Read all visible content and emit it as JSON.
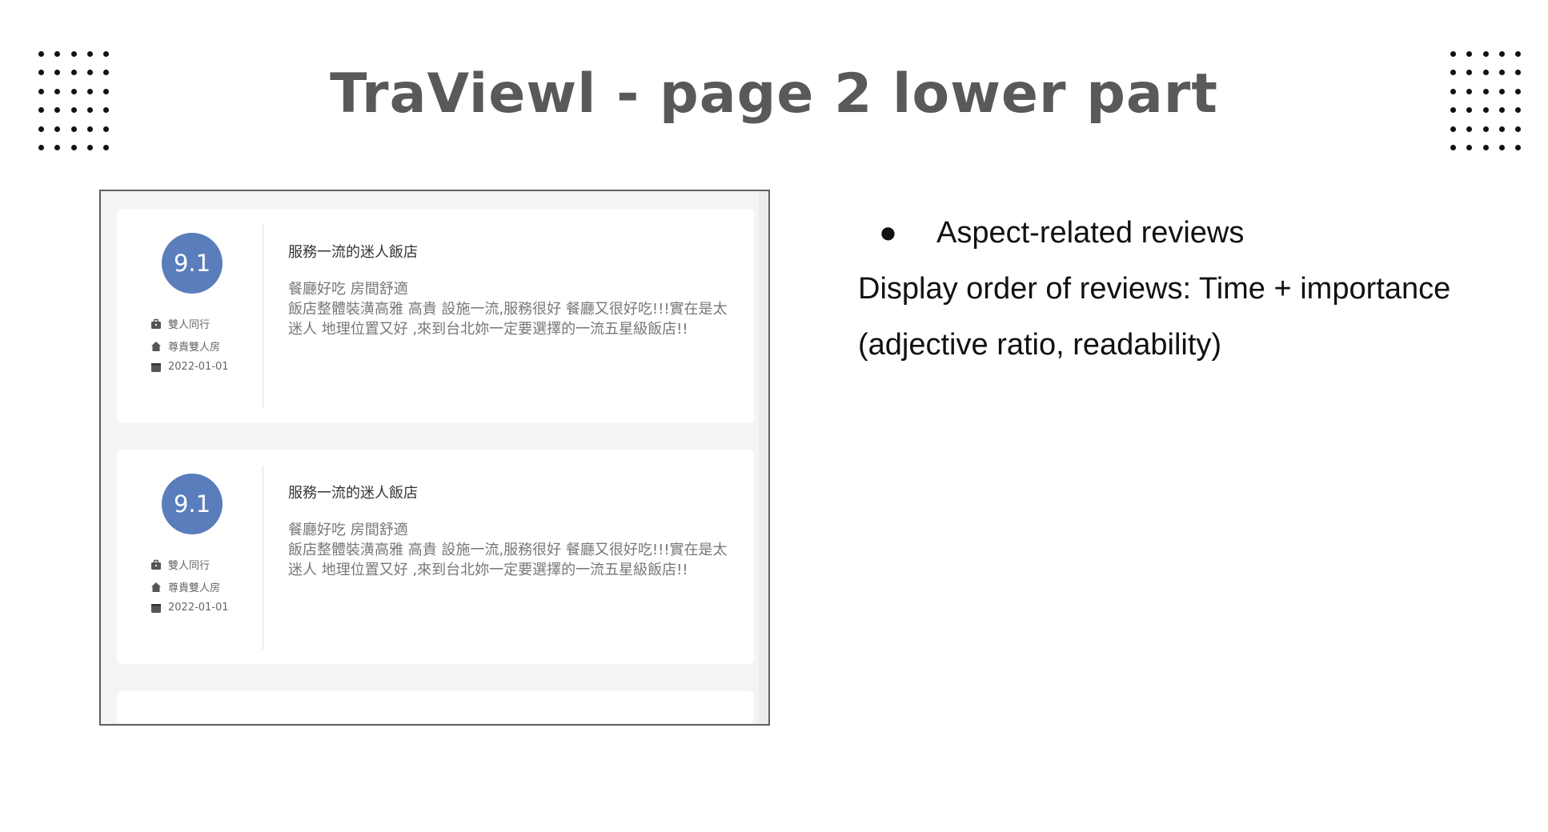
{
  "slide": {
    "title": "TraViewl - page 2 lower part"
  },
  "reviews": [
    {
      "score": "9.1",
      "travel_type": "雙人同行",
      "room_type": "尊貴雙人房",
      "date": "2022-01-01",
      "title": "服務一流的迷人飯店",
      "summary": "餐廳好吃 房間舒適",
      "body": "飯店整體裝潢高雅 高貴 設施一流,服務很好 餐廳又很好吃!!!實在是太迷人 地理位置又好 ,來到台北妳一定要選擇的一流五星級飯店!!"
    },
    {
      "score": "9.1",
      "travel_type": "雙人同行",
      "room_type": "尊貴雙人房",
      "date": "2022-01-01",
      "title": "服務一流的迷人飯店",
      "summary": "餐廳好吃 房間舒適",
      "body": "飯店整體裝潢高雅 高貴 設施一流,服務很好 餐廳又很好吃!!!實在是太迷人 地理位置又好 ,來到台北妳一定要選擇的一流五星級飯店!!"
    }
  ],
  "notes": {
    "bullet_symbol": "●",
    "bullet": "Aspect-related reviews",
    "line1": "Display order of reviews: Time + importance",
    "line2": "(adjective ratio, readability)"
  },
  "icons": {
    "travel_type": "bag-icon",
    "room_type": "home-icon",
    "date": "calendar-icon"
  },
  "colors": {
    "score_badge": "#5a7dbb",
    "title": "#595959"
  }
}
